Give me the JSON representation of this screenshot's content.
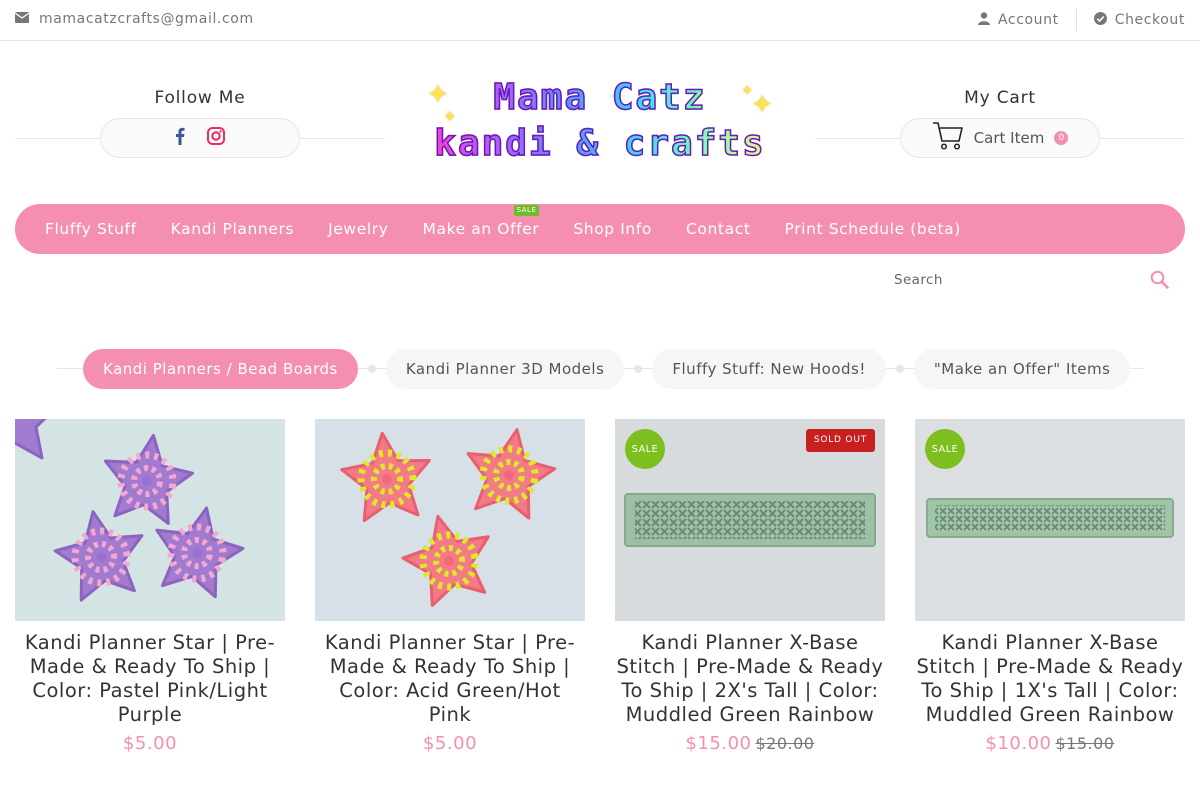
{
  "topbar": {
    "email": "mamacatzcrafts@gmail.com",
    "account_label": "Account",
    "checkout_label": "Checkout"
  },
  "header": {
    "follow_title": "Follow Me",
    "cart_title": "My Cart",
    "cart_label": "Cart Item",
    "cart_count": "0",
    "logo_line1": "Mama Catz",
    "logo_line2": "kandi & crafts"
  },
  "nav": {
    "items": [
      {
        "label": "Fluffy Stuff"
      },
      {
        "label": "Kandi Planners"
      },
      {
        "label": "Jewelry"
      },
      {
        "label": "Make an Offer",
        "tag": "SALE"
      },
      {
        "label": "Shop Info"
      },
      {
        "label": "Contact"
      },
      {
        "label": "Print Schedule (beta)"
      }
    ]
  },
  "search": {
    "placeholder": "Search"
  },
  "categories": [
    {
      "label": "Kandi Planners / Bead Boards",
      "active": true
    },
    {
      "label": "Kandi Planner 3D Models"
    },
    {
      "label": "Fluffy Stuff: New Hoods!"
    },
    {
      "label": "\"Make an Offer\" Items"
    }
  ],
  "products": [
    {
      "title": "Kandi Planner Star | Pre-Made & Ready To Ship | Color: Pastel Pink/Light Purple",
      "price": "$5.00"
    },
    {
      "title": "Kandi Planner Star | Pre-Made & Ready To Ship | Color: Acid Green/Hot Pink",
      "price": "$5.00"
    },
    {
      "title": "Kandi Planner X-Base Stitch | Pre-Made & Ready To Ship | 2X's Tall | Color: Muddled Green Rainbow",
      "price": "$15.00",
      "old_price": "$20.00",
      "sale_badge": "SALE",
      "soldout_badge": "SOLD OUT"
    },
    {
      "title": "Kandi Planner X-Base Stitch | Pre-Made & Ready To Ship | 1X's Tall | Color: Muddled Green Rainbow",
      "price": "$10.00",
      "old_price": "$15.00",
      "sale_badge": "SALE"
    }
  ],
  "colors": {
    "accent_pink": "#f48fb1",
    "sale_green": "#7dbf1f",
    "soldout_red": "#c8201f",
    "facebook_blue": "#3b5998",
    "instagram_pink": "#e1306c"
  },
  "icons": [
    "envelope-icon",
    "user-icon",
    "check-circle-icon",
    "facebook-icon",
    "instagram-icon",
    "cart-icon",
    "search-icon"
  ]
}
